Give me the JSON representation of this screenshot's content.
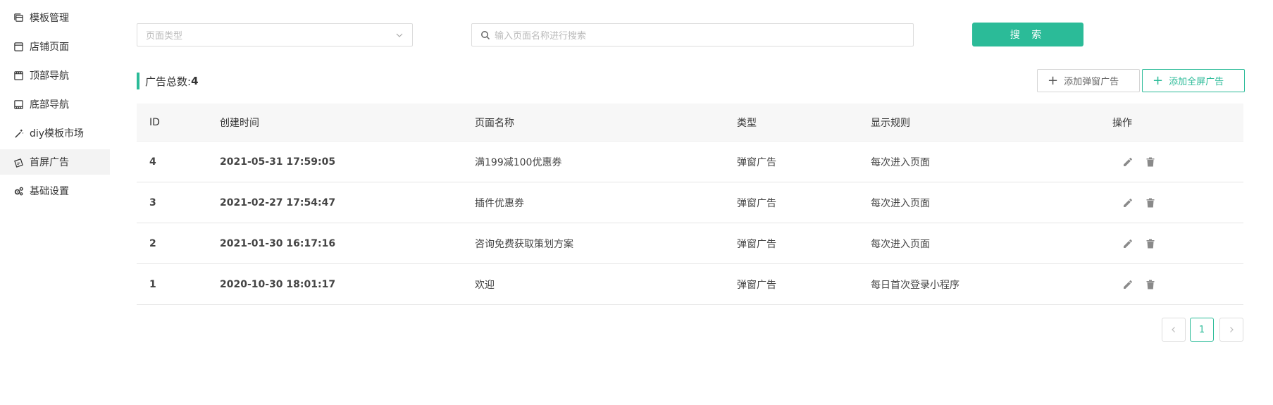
{
  "sidebar": {
    "items": [
      {
        "label": "模板管理",
        "icon": "template-icon"
      },
      {
        "label": "店铺页面",
        "icon": "page-icon"
      },
      {
        "label": "顶部导航",
        "icon": "top-nav-icon"
      },
      {
        "label": "底部导航",
        "icon": "bottom-nav-icon"
      },
      {
        "label": "diy模板市场",
        "icon": "magic-wand-icon"
      },
      {
        "label": "首屏广告",
        "icon": "ad-icon",
        "active": true
      },
      {
        "label": "基础设置",
        "icon": "gear-icon"
      }
    ]
  },
  "filters": {
    "page_type_placeholder": "页面类型",
    "search_placeholder": "输入页面名称进行搜索",
    "search_button": "搜 索"
  },
  "summary": {
    "label": "广告总数:",
    "count": "4"
  },
  "actions": {
    "add_popup": "添加弹窗广告",
    "add_fullscreen": "添加全屏广告"
  },
  "table": {
    "headers": {
      "id": "ID",
      "time": "创建时间",
      "name": "页面名称",
      "type": "类型",
      "rule": "显示规则",
      "op": "操作"
    },
    "rows": [
      {
        "id": "4",
        "time": "2021-05-31 17:59:05",
        "name": "满199减100优惠券",
        "type": "弹窗广告",
        "rule": "每次进入页面"
      },
      {
        "id": "3",
        "time": "2021-02-27 17:54:47",
        "name": "插件优惠券",
        "type": "弹窗广告",
        "rule": "每次进入页面"
      },
      {
        "id": "2",
        "time": "2021-01-30 16:17:16",
        "name": "咨询免费获取策划方案",
        "type": "弹窗广告",
        "rule": "每次进入页面"
      },
      {
        "id": "1",
        "time": "2020-10-30 18:01:17",
        "name": "欢迎",
        "type": "弹窗广告",
        "rule": "每日首次登录小程序"
      }
    ]
  },
  "pagination": {
    "current_page": "1"
  },
  "colors": {
    "accent": "#2bbb98",
    "icon_gray": "#8a8a8a"
  }
}
